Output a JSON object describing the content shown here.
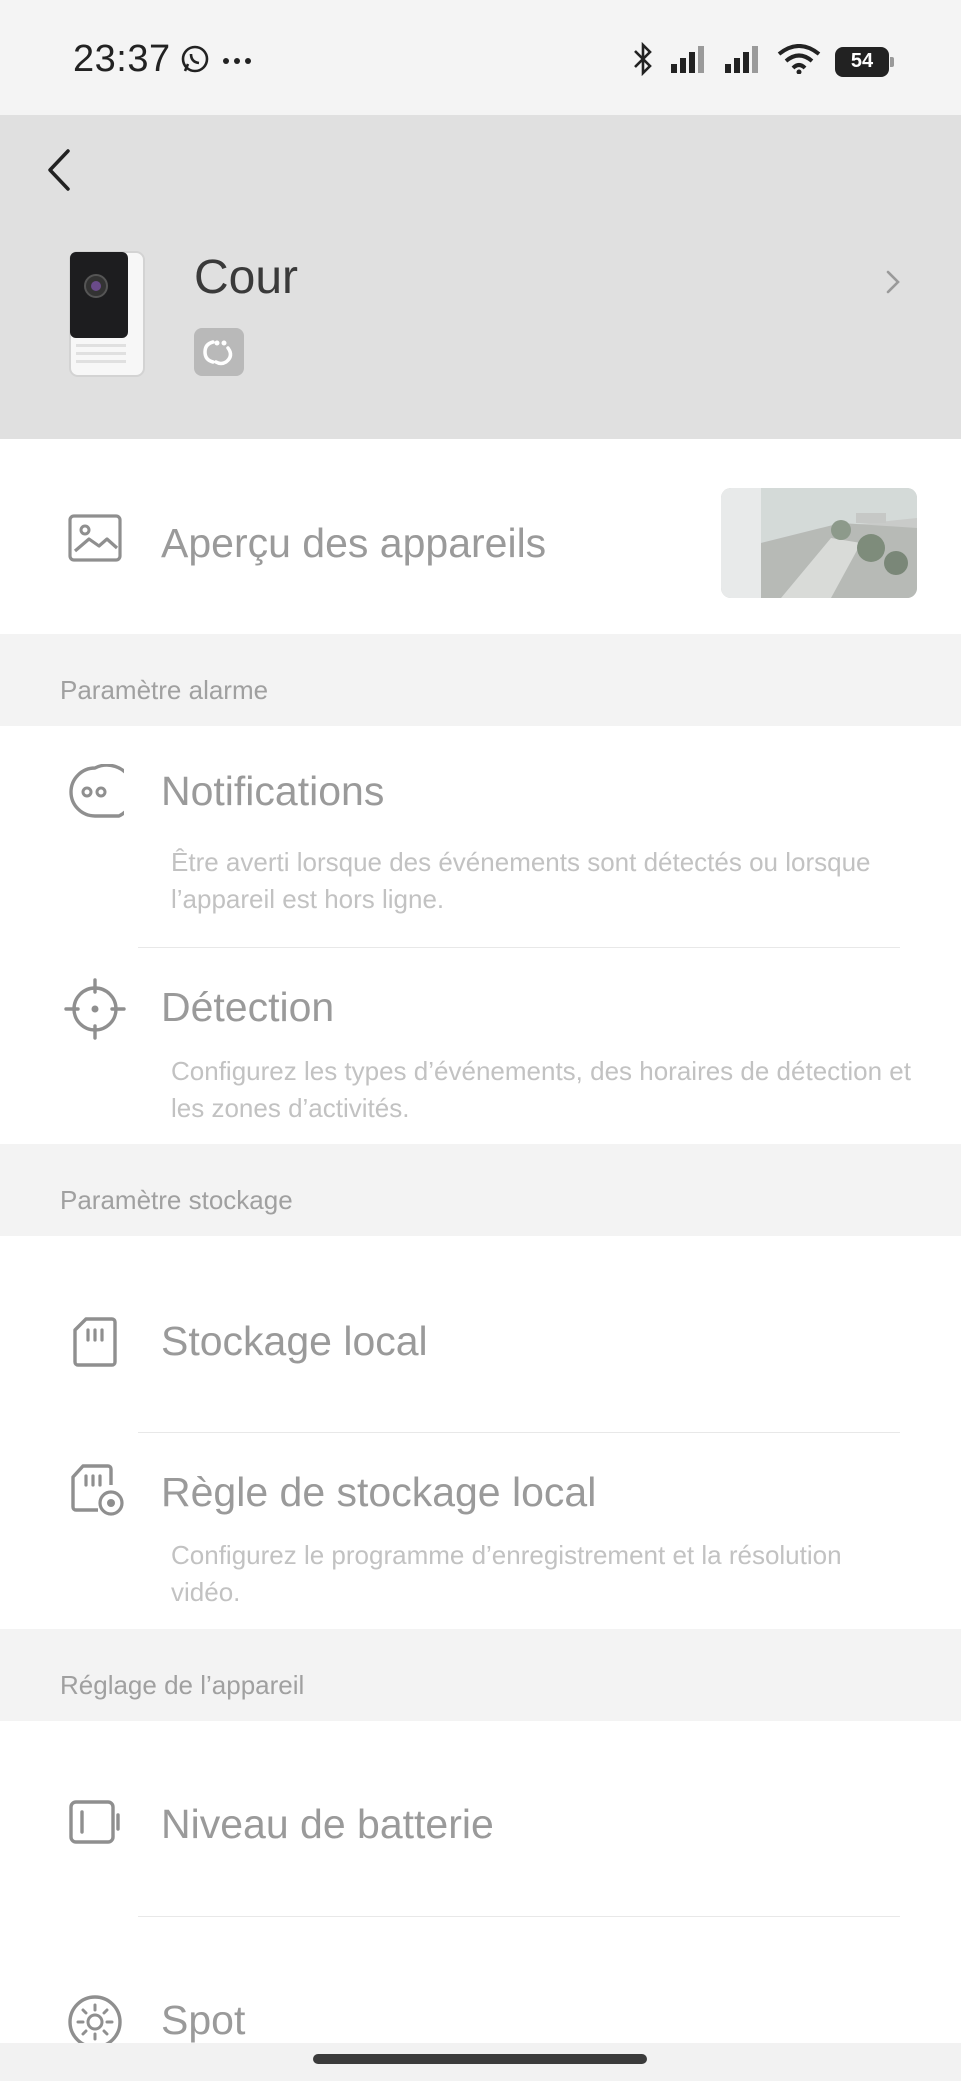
{
  "status_bar": {
    "time": "23:37",
    "battery_level": "54",
    "icons": [
      "whatsapp-icon",
      "more-dots-icon",
      "bluetooth-icon",
      "signal-icon",
      "signal-icon",
      "wifi-icon",
      "battery-icon"
    ]
  },
  "header": {
    "device_name": "Cour"
  },
  "preview": {
    "label": "Aperçu des appareils"
  },
  "groups": {
    "alarm": "Paramètre alarme",
    "storage": "Paramètre stockage",
    "device": "Réglage de l’appareil"
  },
  "items": {
    "notifications": {
      "title": "Notifications",
      "desc": "Être averti lorsque des événements sont détectés ou lorsque l’appareil est hors ligne."
    },
    "detection": {
      "title": "Détection",
      "desc": "Configurez les types d’événements, des horaires de détection et les zones d’activités."
    },
    "local_storage": {
      "title": "Stockage local"
    },
    "storage_rule": {
      "title": "Règle de stockage local",
      "desc": "Configurez le programme d’enregistrement et la résolution vidéo."
    },
    "battery": {
      "title": "Niveau de batterie"
    },
    "spot": {
      "title": "Spot"
    }
  }
}
